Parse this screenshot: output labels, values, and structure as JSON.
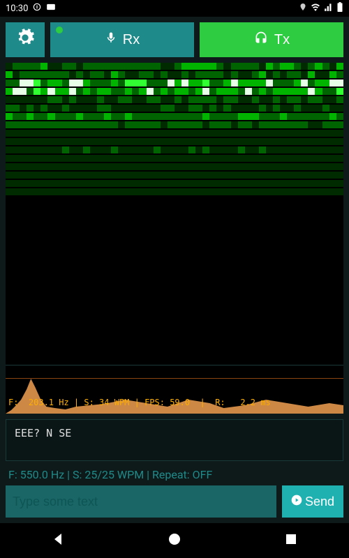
{
  "status_bar": {
    "time": "10:30",
    "pip_icon": "pip",
    "card_icon": "card"
  },
  "icons": {
    "settings": "gears-icon",
    "mic": "mic-icon",
    "headset": "headset-icon",
    "play": "play-icon",
    "location": "location-icon",
    "wifi": "wifi-icon",
    "signal": "signal-icon",
    "battery": "battery-icon"
  },
  "buttons": {
    "rx_label": "Rx",
    "tx_label": "Tx",
    "send_label": "Send"
  },
  "spectrum_readout": "F:  203.1 Hz | S: 34 WPM | FPS: 59.0  |  R:   2.2 ms",
  "decoded_text": "EEE? N SE",
  "status_line": "F: 550.0 Hz | S: 25/25 WPM | Repeat: OFF",
  "input": {
    "placeholder": "Type some text",
    "value": ""
  },
  "colors": {
    "teal": "#1f8a8a",
    "green": "#2ecc40",
    "amber": "#ffb000"
  }
}
